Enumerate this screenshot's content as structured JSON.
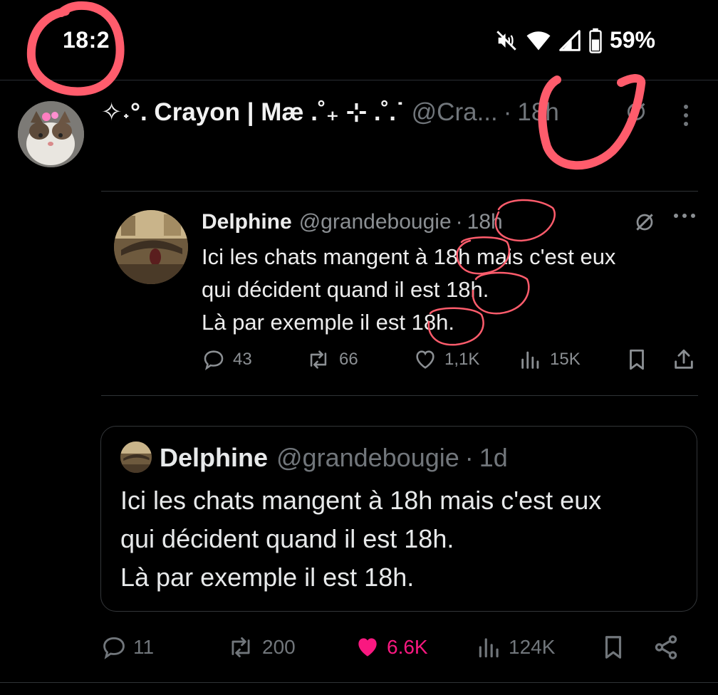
{
  "status_bar": {
    "time": "18:2",
    "battery_percent": "59%",
    "icons": [
      "mute-icon",
      "wifi-icon",
      "signal-icon",
      "battery-icon"
    ]
  },
  "tweet": {
    "display_name": "✧˖°. Crayon | Mæ .˚₊ ⊹ .˚.˙",
    "handle": "@Cra...",
    "separator": "·",
    "time": "18h"
  },
  "embedded_tweet": {
    "display_name": "Delphine",
    "handle": "@grandebougie",
    "separator": "·",
    "time": "18h",
    "text_lines": [
      "Ici les chats mangent à 18h mais c'est eux",
      "qui décident quand il est 18h.",
      "Là par exemple il est 18h."
    ],
    "actions": {
      "replies": "43",
      "reposts": "66",
      "likes": "1,1K",
      "views": "15K"
    }
  },
  "quoted_tweet": {
    "display_name": "Delphine",
    "handle": "@grandebougie",
    "separator": "·",
    "time": "1d",
    "text_lines": [
      "Ici les chats mangent à 18h mais c'est eux",
      "qui décident quand il est 18h.",
      "Là par exemple il est 18h."
    ]
  },
  "actions": {
    "replies": "11",
    "reposts": "200",
    "likes": "6.6K",
    "views": "124K"
  },
  "colors": {
    "background": "#000000",
    "text": "#e7e9ea",
    "muted": "#71767b",
    "like": "#f91880",
    "annotation": "#ff5c6c"
  }
}
